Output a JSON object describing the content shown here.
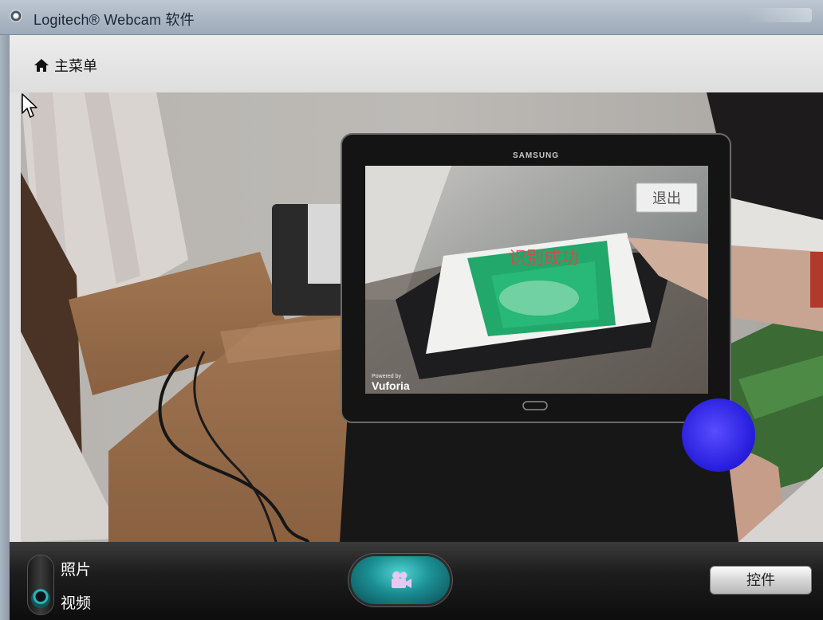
{
  "window": {
    "title": "Logitech® Webcam 软件"
  },
  "menu": {
    "home_label": "主菜单"
  },
  "video_feed": {
    "tablet_brand": "SAMSUNG",
    "tablet_exit_label": "退出",
    "tablet_status_text": "识别成功",
    "tablet_powered_by": "Powered by",
    "tablet_vuforia": "Vuforia"
  },
  "controls": {
    "mode_photo": "照片",
    "mode_video": "视频",
    "selected_mode": "视频",
    "controls_button_label": "控件"
  },
  "colors": {
    "capture_accent": "#1b8f94",
    "click_indicator": "#2222e6"
  }
}
